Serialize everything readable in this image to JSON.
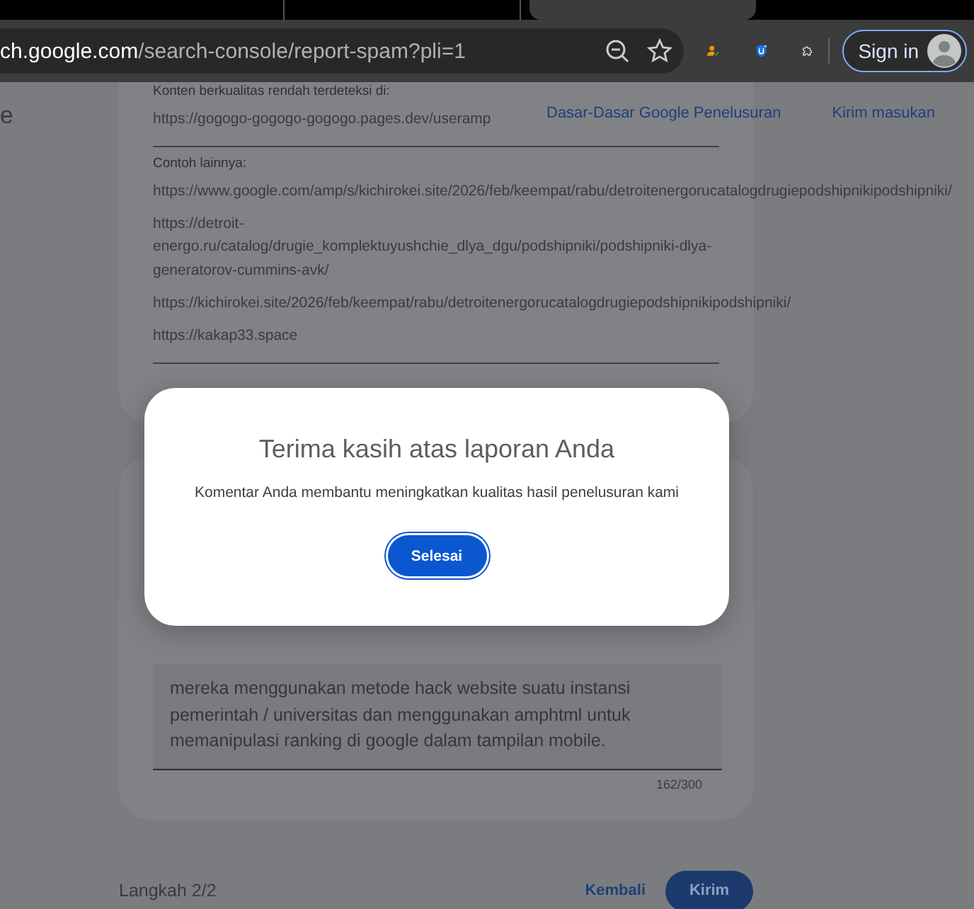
{
  "browser": {
    "tabs": [
      {
        "selected": false
      },
      {
        "selected": false
      },
      {
        "selected": true
      }
    ],
    "url_host": "ch.google.com",
    "url_path": "/search-console/report-spam?pli=1",
    "sign_in": "Sign in"
  },
  "sidebar_fragment": "e",
  "header_links": [
    "Dasar-Dasar Google Penelusuran",
    "Kirim masukan"
  ],
  "report": {
    "detected_label": "Konten berkualitas rendah terdeteksi di:",
    "detected_url": "https://gogogo-gogogo-gogogo.pages.dev/useramp",
    "more_label": "Contoh lainnya:",
    "more_urls": [
      "https://www.google.com/amp/s/kichirokei.site/2026/feb/keempat/rabu/detroitenergorucatalogdrugiepodshipnikipodshipniki/",
      "https://detroit-energo.ru/catalog/drugie_komplektuyushchie_dlya_dgu/podshipniki/podshipniki-dlya-generatorov-cummins-avk/",
      "https://kichirokei.site/2026/feb/keempat/rabu/detroitenergorucatalogdrugiepodshipnikipodshipniki/",
      "https://kakap33.space"
    ],
    "comment": "mereka menggunakan metode hack website suatu instansi pemerintah / universitas dan menggunakan amphtml untuk memanipulasi ranking di google dalam tampilan mobile.",
    "counter": "162/300"
  },
  "footer": {
    "step": "Langkah 2/2",
    "back": "Kembali",
    "submit": "Kirim"
  },
  "dialog": {
    "title": "Terima kasih atas laporan Anda",
    "message": "Komentar Anda membantu meningkatkan kualitas hasil penelusuran kami",
    "button": "Selesai"
  }
}
